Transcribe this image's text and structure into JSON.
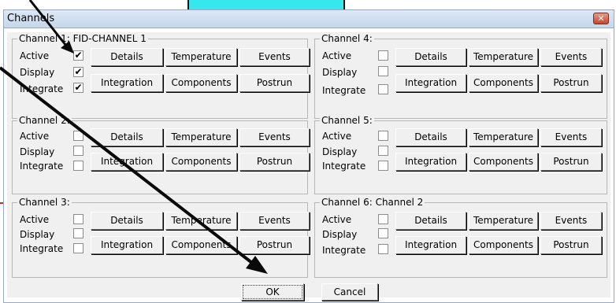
{
  "window": {
    "title": "Channels",
    "close_glyph": "✕"
  },
  "row_labels": {
    "active": "Active",
    "display": "Display",
    "integrate": "Integrate"
  },
  "buttons": {
    "details": "Details",
    "temperature": "Temperature",
    "events": "Events",
    "integration": "Integration",
    "components": "Components",
    "postrun": "Postrun"
  },
  "channels": [
    {
      "label": "Channel 1: FID-CHANNEL 1",
      "active": true,
      "display": true,
      "integrate": true
    },
    {
      "label": "Channel 2:",
      "active": false,
      "display": false,
      "integrate": false
    },
    {
      "label": "Channel 3:",
      "active": false,
      "display": false,
      "integrate": false
    },
    {
      "label": "Channel 4:",
      "active": false,
      "display": false,
      "integrate": false
    },
    {
      "label": "Channel 5:",
      "active": false,
      "display": false,
      "integrate": false
    },
    {
      "label": "Channel 6: Channel 2",
      "active": false,
      "display": false,
      "integrate": false
    }
  ],
  "dialog_buttons": {
    "ok": "OK",
    "cancel": "Cancel"
  },
  "check_glyph": "✔",
  "colors": {
    "annotation_arrow": "#0a0a0a",
    "highlight_box": "#36e8ee",
    "close_button": "#c9452b"
  }
}
